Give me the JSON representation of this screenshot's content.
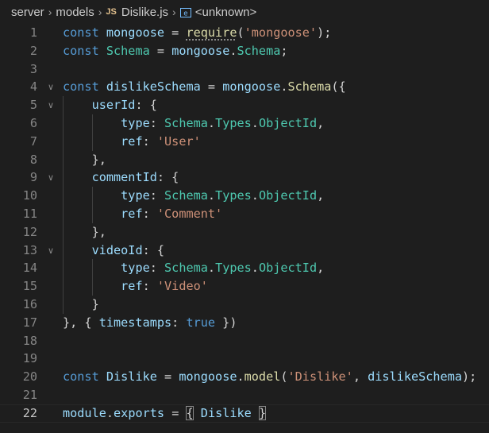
{
  "breadcrumb": {
    "items": [
      "server",
      "models",
      "Dislike.js",
      "<unknown>"
    ],
    "file_icon": "JS",
    "symbol_icon": "variable-symbol-icon"
  },
  "colors": {
    "background": "#1e1e1e",
    "keyword": "#569cd6",
    "variable": "#9cdcfe",
    "function": "#dcdcaa",
    "string": "#ce9178",
    "class": "#4ec9b0",
    "line_number": "#858585"
  },
  "editor": {
    "current_line": 22,
    "lines": [
      {
        "n": "1",
        "fold": false,
        "tokens": [
          [
            "kw",
            "const"
          ],
          [
            "pun",
            " "
          ],
          [
            "var",
            "mongoose"
          ],
          [
            "pun",
            " = "
          ],
          [
            "fn",
            "require"
          ],
          [
            "pun",
            "("
          ],
          [
            "str",
            "'mongoose'"
          ],
          [
            "pun",
            ");"
          ]
        ]
      },
      {
        "n": "2",
        "fold": false,
        "tokens": [
          [
            "kw",
            "const"
          ],
          [
            "pun",
            " "
          ],
          [
            "cls",
            "Schema"
          ],
          [
            "pun",
            " = "
          ],
          [
            "var",
            "mongoose"
          ],
          [
            "pun",
            "."
          ],
          [
            "cls",
            "Schema"
          ],
          [
            "pun",
            ";"
          ]
        ]
      },
      {
        "n": "3",
        "fold": false,
        "tokens": []
      },
      {
        "n": "4",
        "fold": true,
        "tokens": [
          [
            "kw",
            "const"
          ],
          [
            "pun",
            " "
          ],
          [
            "var",
            "dislikeSchema"
          ],
          [
            "pun",
            " = "
          ],
          [
            "var",
            "mongoose"
          ],
          [
            "pun",
            "."
          ],
          [
            "fn",
            "Schema"
          ],
          [
            "pun",
            "({"
          ]
        ]
      },
      {
        "n": "5",
        "fold": true,
        "tokens": [
          [
            "pun",
            "    "
          ],
          [
            "var",
            "userId"
          ],
          [
            "pun",
            ": {"
          ]
        ]
      },
      {
        "n": "6",
        "fold": false,
        "tokens": [
          [
            "pun",
            "        "
          ],
          [
            "var",
            "type"
          ],
          [
            "pun",
            ": "
          ],
          [
            "cls",
            "Schema"
          ],
          [
            "pun",
            "."
          ],
          [
            "cls",
            "Types"
          ],
          [
            "pun",
            "."
          ],
          [
            "cls",
            "ObjectId"
          ],
          [
            "pun",
            ","
          ]
        ]
      },
      {
        "n": "7",
        "fold": false,
        "tokens": [
          [
            "pun",
            "        "
          ],
          [
            "var",
            "ref"
          ],
          [
            "pun",
            ": "
          ],
          [
            "str",
            "'User'"
          ]
        ]
      },
      {
        "n": "8",
        "fold": false,
        "tokens": [
          [
            "pun",
            "    },"
          ]
        ]
      },
      {
        "n": "9",
        "fold": true,
        "tokens": [
          [
            "pun",
            "    "
          ],
          [
            "var",
            "commentId"
          ],
          [
            "pun",
            ": {"
          ]
        ]
      },
      {
        "n": "10",
        "fold": false,
        "tokens": [
          [
            "pun",
            "        "
          ],
          [
            "var",
            "type"
          ],
          [
            "pun",
            ": "
          ],
          [
            "cls",
            "Schema"
          ],
          [
            "pun",
            "."
          ],
          [
            "cls",
            "Types"
          ],
          [
            "pun",
            "."
          ],
          [
            "cls",
            "ObjectId"
          ],
          [
            "pun",
            ","
          ]
        ]
      },
      {
        "n": "11",
        "fold": false,
        "tokens": [
          [
            "pun",
            "        "
          ],
          [
            "var",
            "ref"
          ],
          [
            "pun",
            ": "
          ],
          [
            "str",
            "'Comment'"
          ]
        ]
      },
      {
        "n": "12",
        "fold": false,
        "tokens": [
          [
            "pun",
            "    },"
          ]
        ]
      },
      {
        "n": "13",
        "fold": true,
        "tokens": [
          [
            "pun",
            "    "
          ],
          [
            "var",
            "videoId"
          ],
          [
            "pun",
            ": {"
          ]
        ]
      },
      {
        "n": "14",
        "fold": false,
        "tokens": [
          [
            "pun",
            "        "
          ],
          [
            "var",
            "type"
          ],
          [
            "pun",
            ": "
          ],
          [
            "cls",
            "Schema"
          ],
          [
            "pun",
            "."
          ],
          [
            "cls",
            "Types"
          ],
          [
            "pun",
            "."
          ],
          [
            "cls",
            "ObjectId"
          ],
          [
            "pun",
            ","
          ]
        ]
      },
      {
        "n": "15",
        "fold": false,
        "tokens": [
          [
            "pun",
            "        "
          ],
          [
            "var",
            "ref"
          ],
          [
            "pun",
            ": "
          ],
          [
            "str",
            "'Video'"
          ]
        ]
      },
      {
        "n": "16",
        "fold": false,
        "tokens": [
          [
            "pun",
            "    }"
          ]
        ]
      },
      {
        "n": "17",
        "fold": false,
        "tokens": [
          [
            "pun",
            "}, { "
          ],
          [
            "var",
            "timestamps"
          ],
          [
            "pun",
            ": "
          ],
          [
            "kw",
            "true"
          ],
          [
            "pun",
            " })"
          ]
        ]
      },
      {
        "n": "18",
        "fold": false,
        "tokens": []
      },
      {
        "n": "19",
        "fold": false,
        "tokens": []
      },
      {
        "n": "20",
        "fold": false,
        "tokens": [
          [
            "kw",
            "const"
          ],
          [
            "pun",
            " "
          ],
          [
            "var",
            "Dislike"
          ],
          [
            "pun",
            " = "
          ],
          [
            "var",
            "mongoose"
          ],
          [
            "pun",
            "."
          ],
          [
            "fn",
            "model"
          ],
          [
            "pun",
            "("
          ],
          [
            "str",
            "'Dislike'"
          ],
          [
            "pun",
            ", "
          ],
          [
            "var",
            "dislikeSchema"
          ],
          [
            "pun",
            ");"
          ]
        ]
      },
      {
        "n": "21",
        "fold": false,
        "tokens": []
      },
      {
        "n": "22",
        "fold": false,
        "tokens": [
          [
            "var",
            "module"
          ],
          [
            "pun",
            "."
          ],
          [
            "var",
            "exports"
          ],
          [
            "pun",
            " = "
          ],
          [
            "pun",
            "{"
          ],
          [
            "pun",
            " "
          ],
          [
            "var",
            "Dislike"
          ],
          [
            "pun",
            " "
          ],
          [
            "pun",
            "}"
          ]
        ]
      }
    ]
  }
}
